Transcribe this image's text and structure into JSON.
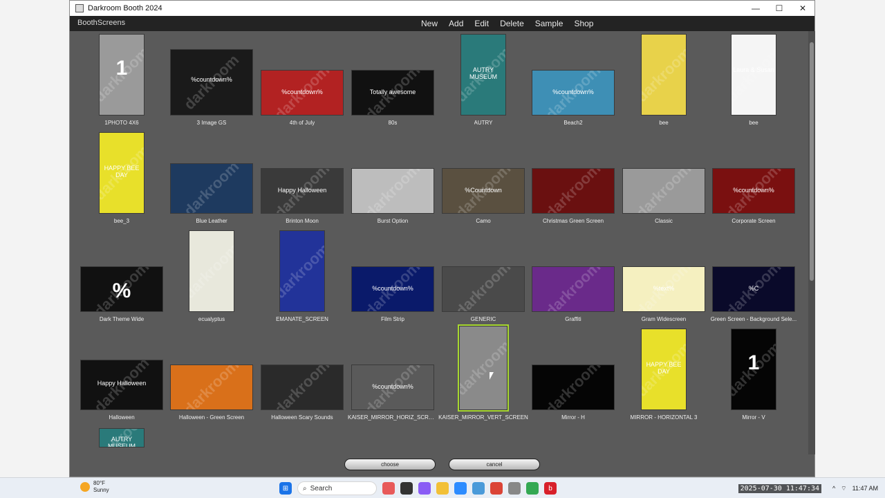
{
  "window": {
    "title": "Darkroom Booth 2024"
  },
  "window_controls": {
    "minimize": "—",
    "maximize": "☐",
    "close": "✕"
  },
  "menubar": {
    "brand": "BoothScreens",
    "items": [
      "New",
      "Add",
      "Edit",
      "Delete",
      "Sample",
      "Shop"
    ]
  },
  "gallery": {
    "tiles": [
      {
        "label": "1PHOTO 4X6",
        "text": "1",
        "bg": "#9a9a9a"
      },
      {
        "label": "3 Image GS",
        "text": "%countdown%",
        "bg": "#1a1a1a"
      },
      {
        "label": "4th of July",
        "text": "%countdown%",
        "bg": "#b22222"
      },
      {
        "label": "80s",
        "text": "Totally awesome",
        "bg": "#111111"
      },
      {
        "label": "AUTRY",
        "text": "AUTRY MUSEUM",
        "bg": "#2a7a7a"
      },
      {
        "label": "Beach2",
        "text": "%countdown%",
        "bg": "#3e8fb5"
      },
      {
        "label": "bee",
        "text": "",
        "bg": "#e8d24a"
      },
      {
        "label": "bee",
        "text": "Laura & Susan",
        "bg": "#f5f5f5"
      },
      {
        "label": "bee_3",
        "text": "HAPPY BEE DAY",
        "bg": "#e8e02a"
      },
      {
        "label": "Blue Leather",
        "text": "",
        "bg": "#1e3a5f"
      },
      {
        "label": "Brinton Moon",
        "text": "Happy Halloween",
        "bg": "#3a3a3a"
      },
      {
        "label": "Burst Option",
        "text": "",
        "bg": "#bdbdbd"
      },
      {
        "label": "Camo",
        "text": "%Countdown",
        "bg": "#5a5040"
      },
      {
        "label": "Christmas Green Screen",
        "text": "",
        "bg": "#6a1010"
      },
      {
        "label": "Classic",
        "text": "",
        "bg": "#9a9a9a"
      },
      {
        "label": "Corporate Screen",
        "text": "%countdown%",
        "bg": "#7a1010"
      },
      {
        "label": "Dark Theme Wide",
        "text": "%",
        "bg": "#111111"
      },
      {
        "label": "ecualyptus",
        "text": "",
        "bg": "#e8e8dc"
      },
      {
        "label": "EMANATE_SCREEN",
        "text": "",
        "bg": "#223399"
      },
      {
        "label": "Film Strip",
        "text": "%countdown%",
        "bg": "#0a1a6a"
      },
      {
        "label": "GENERIC",
        "text": "",
        "bg": "#4a4a4a"
      },
      {
        "label": "Graffiti",
        "text": "",
        "bg": "#6a2a8a"
      },
      {
        "label": "Gram Widescreen",
        "text": "%text%",
        "bg": "#f5f0c0"
      },
      {
        "label": "Green Screen - Background Sele...",
        "text": "%C",
        "bg": "#0a0a2a"
      },
      {
        "label": "Halloween",
        "text": "Happy Halloween",
        "bg": "#111111"
      },
      {
        "label": "Halloween - Green Screen",
        "text": "",
        "bg": "#d9701a"
      },
      {
        "label": "Halloween Scary Sounds",
        "text": "",
        "bg": "#2a2a2a"
      },
      {
        "label": "KAISER_MIRROR_HORIZ_SCREEN",
        "text": "%countdown%",
        "bg": "#5a5a5a"
      },
      {
        "label": "KAISER_MIRROR_VERT_SCREEN",
        "text": "",
        "bg": "#8a8a8a"
      },
      {
        "label": "Mirror - H",
        "text": "",
        "bg": "#050505"
      },
      {
        "label": "MIRROR - HORIZONTAL 3",
        "text": "HAPPY BEE DAY",
        "bg": "#e8e02a"
      },
      {
        "label": "Mirror - V",
        "text": "1",
        "bg": "#050505"
      },
      {
        "label": "",
        "text": "AUTRY MUSEUM",
        "bg": "#2a7a7a"
      }
    ]
  },
  "buttons": {
    "choose": "choose",
    "cancel": "cancel"
  },
  "taskbar": {
    "weather_temp": "80°F",
    "weather_desc": "Sunny",
    "search_placeholder": "Search",
    "time": "11:47 AM",
    "timestamp": "2025-07-30 11:47:34"
  },
  "colors": {
    "selected_outline": "#a8d830",
    "window_bg": "#5a5a5a"
  }
}
